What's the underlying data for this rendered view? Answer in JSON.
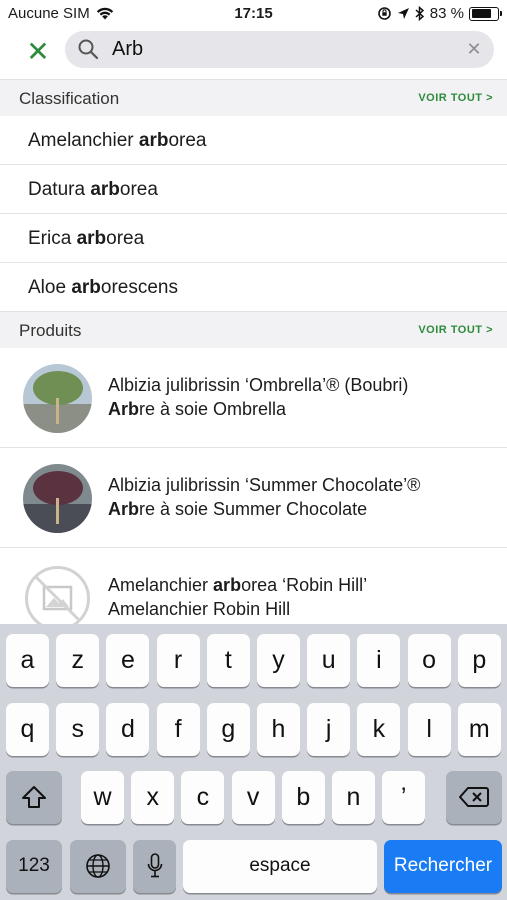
{
  "status_bar": {
    "carrier": "Aucune SIM",
    "time": "17:15",
    "battery_text": "83 %",
    "battery_level": 0.83
  },
  "search": {
    "value": "Arb",
    "placeholder": ""
  },
  "sections": {
    "classification": {
      "title": "Classification",
      "see_all": "VOIR TOUT >",
      "items": [
        {
          "prefix": "Amelanchier ",
          "match": "arb",
          "suffix": "orea"
        },
        {
          "prefix": "Datura ",
          "match": "arb",
          "suffix": "orea"
        },
        {
          "prefix": "Erica ",
          "match": "arb",
          "suffix": "orea"
        },
        {
          "prefix": "Aloe ",
          "match": "arb",
          "suffix": "orescens"
        }
      ]
    },
    "produits": {
      "title": "Produits",
      "see_all": "VOIR TOUT >",
      "items": [
        {
          "line1_prefix": "Albizia julibrissin ‘Ombrella’® (Boubri)",
          "line1_match": "",
          "line1_suffix": "",
          "line2_match": "Arb",
          "line2_suffix": "re à soie Ombrella",
          "image": "tree-photo"
        },
        {
          "line1_prefix": "Albizia julibrissin ‘Summer Chocolate’®",
          "line1_match": "",
          "line1_suffix": "",
          "line2_match": "Arb",
          "line2_suffix": "re à soie Summer Chocolate",
          "image": "tree-photo"
        },
        {
          "line1_prefix": "Amelanchier ",
          "line1_match": "arb",
          "line1_suffix": "orea ‘Robin Hill’",
          "line2_match": "",
          "line2_suffix": "Amelanchier Robin Hill",
          "image": "no-image-icon"
        }
      ]
    }
  },
  "keyboard": {
    "row1": [
      "a",
      "z",
      "e",
      "r",
      "t",
      "y",
      "u",
      "i",
      "o",
      "p"
    ],
    "row2": [
      "q",
      "s",
      "d",
      "f",
      "g",
      "h",
      "j",
      "k",
      "l",
      "m"
    ],
    "row3": [
      "w",
      "x",
      "c",
      "v",
      "b",
      "n",
      "’"
    ],
    "numbers": "123",
    "space": "espace",
    "search": "Rechercher"
  },
  "colors": {
    "accent_green": "#2e8b3d",
    "keyboard_bg": "#d1d4da",
    "search_key": "#1a7cf5"
  }
}
